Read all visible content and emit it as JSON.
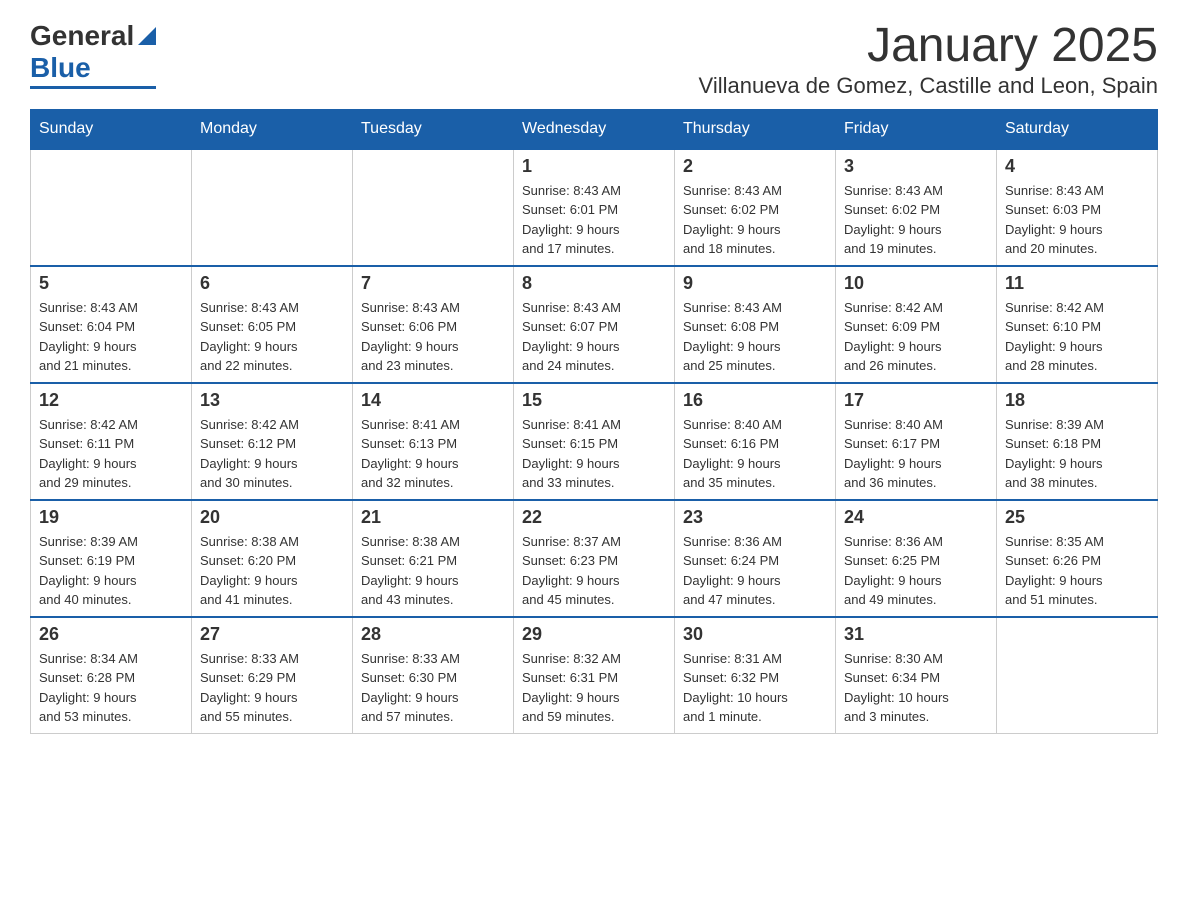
{
  "header": {
    "logo_general": "General",
    "logo_blue": "Blue",
    "month_title": "January 2025",
    "location": "Villanueva de Gomez, Castille and Leon, Spain"
  },
  "weekdays": [
    "Sunday",
    "Monday",
    "Tuesday",
    "Wednesday",
    "Thursday",
    "Friday",
    "Saturday"
  ],
  "weeks": [
    [
      {
        "day": "",
        "info": ""
      },
      {
        "day": "",
        "info": ""
      },
      {
        "day": "",
        "info": ""
      },
      {
        "day": "1",
        "info": "Sunrise: 8:43 AM\nSunset: 6:01 PM\nDaylight: 9 hours\nand 17 minutes."
      },
      {
        "day": "2",
        "info": "Sunrise: 8:43 AM\nSunset: 6:02 PM\nDaylight: 9 hours\nand 18 minutes."
      },
      {
        "day": "3",
        "info": "Sunrise: 8:43 AM\nSunset: 6:02 PM\nDaylight: 9 hours\nand 19 minutes."
      },
      {
        "day": "4",
        "info": "Sunrise: 8:43 AM\nSunset: 6:03 PM\nDaylight: 9 hours\nand 20 minutes."
      }
    ],
    [
      {
        "day": "5",
        "info": "Sunrise: 8:43 AM\nSunset: 6:04 PM\nDaylight: 9 hours\nand 21 minutes."
      },
      {
        "day": "6",
        "info": "Sunrise: 8:43 AM\nSunset: 6:05 PM\nDaylight: 9 hours\nand 22 minutes."
      },
      {
        "day": "7",
        "info": "Sunrise: 8:43 AM\nSunset: 6:06 PM\nDaylight: 9 hours\nand 23 minutes."
      },
      {
        "day": "8",
        "info": "Sunrise: 8:43 AM\nSunset: 6:07 PM\nDaylight: 9 hours\nand 24 minutes."
      },
      {
        "day": "9",
        "info": "Sunrise: 8:43 AM\nSunset: 6:08 PM\nDaylight: 9 hours\nand 25 minutes."
      },
      {
        "day": "10",
        "info": "Sunrise: 8:42 AM\nSunset: 6:09 PM\nDaylight: 9 hours\nand 26 minutes."
      },
      {
        "day": "11",
        "info": "Sunrise: 8:42 AM\nSunset: 6:10 PM\nDaylight: 9 hours\nand 28 minutes."
      }
    ],
    [
      {
        "day": "12",
        "info": "Sunrise: 8:42 AM\nSunset: 6:11 PM\nDaylight: 9 hours\nand 29 minutes."
      },
      {
        "day": "13",
        "info": "Sunrise: 8:42 AM\nSunset: 6:12 PM\nDaylight: 9 hours\nand 30 minutes."
      },
      {
        "day": "14",
        "info": "Sunrise: 8:41 AM\nSunset: 6:13 PM\nDaylight: 9 hours\nand 32 minutes."
      },
      {
        "day": "15",
        "info": "Sunrise: 8:41 AM\nSunset: 6:15 PM\nDaylight: 9 hours\nand 33 minutes."
      },
      {
        "day": "16",
        "info": "Sunrise: 8:40 AM\nSunset: 6:16 PM\nDaylight: 9 hours\nand 35 minutes."
      },
      {
        "day": "17",
        "info": "Sunrise: 8:40 AM\nSunset: 6:17 PM\nDaylight: 9 hours\nand 36 minutes."
      },
      {
        "day": "18",
        "info": "Sunrise: 8:39 AM\nSunset: 6:18 PM\nDaylight: 9 hours\nand 38 minutes."
      }
    ],
    [
      {
        "day": "19",
        "info": "Sunrise: 8:39 AM\nSunset: 6:19 PM\nDaylight: 9 hours\nand 40 minutes."
      },
      {
        "day": "20",
        "info": "Sunrise: 8:38 AM\nSunset: 6:20 PM\nDaylight: 9 hours\nand 41 minutes."
      },
      {
        "day": "21",
        "info": "Sunrise: 8:38 AM\nSunset: 6:21 PM\nDaylight: 9 hours\nand 43 minutes."
      },
      {
        "day": "22",
        "info": "Sunrise: 8:37 AM\nSunset: 6:23 PM\nDaylight: 9 hours\nand 45 minutes."
      },
      {
        "day": "23",
        "info": "Sunrise: 8:36 AM\nSunset: 6:24 PM\nDaylight: 9 hours\nand 47 minutes."
      },
      {
        "day": "24",
        "info": "Sunrise: 8:36 AM\nSunset: 6:25 PM\nDaylight: 9 hours\nand 49 minutes."
      },
      {
        "day": "25",
        "info": "Sunrise: 8:35 AM\nSunset: 6:26 PM\nDaylight: 9 hours\nand 51 minutes."
      }
    ],
    [
      {
        "day": "26",
        "info": "Sunrise: 8:34 AM\nSunset: 6:28 PM\nDaylight: 9 hours\nand 53 minutes."
      },
      {
        "day": "27",
        "info": "Sunrise: 8:33 AM\nSunset: 6:29 PM\nDaylight: 9 hours\nand 55 minutes."
      },
      {
        "day": "28",
        "info": "Sunrise: 8:33 AM\nSunset: 6:30 PM\nDaylight: 9 hours\nand 57 minutes."
      },
      {
        "day": "29",
        "info": "Sunrise: 8:32 AM\nSunset: 6:31 PM\nDaylight: 9 hours\nand 59 minutes."
      },
      {
        "day": "30",
        "info": "Sunrise: 8:31 AM\nSunset: 6:32 PM\nDaylight: 10 hours\nand 1 minute."
      },
      {
        "day": "31",
        "info": "Sunrise: 8:30 AM\nSunset: 6:34 PM\nDaylight: 10 hours\nand 3 minutes."
      },
      {
        "day": "",
        "info": ""
      }
    ]
  ]
}
